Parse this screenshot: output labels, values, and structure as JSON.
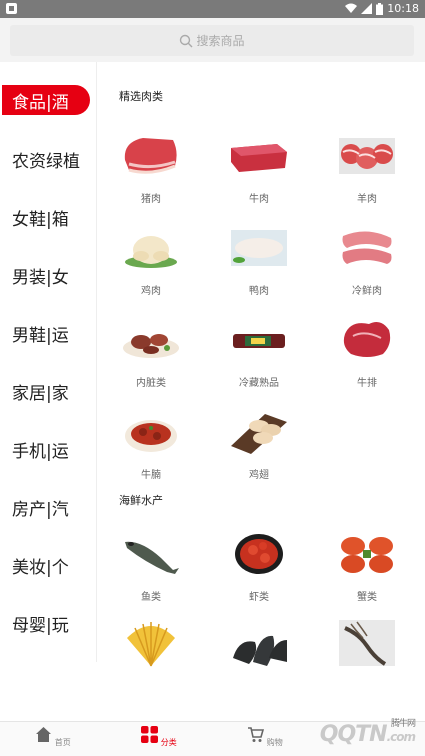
{
  "statusbar": {
    "time": "10:18"
  },
  "search": {
    "placeholder": "搜索商品"
  },
  "sidebar": {
    "items": [
      {
        "label": "食品|酒",
        "active": true
      },
      {
        "label": "农资绿植"
      },
      {
        "label": "女鞋|箱"
      },
      {
        "label": "男装|女"
      },
      {
        "label": "男鞋|运"
      },
      {
        "label": "家居|家"
      },
      {
        "label": "手机|运"
      },
      {
        "label": "房产|汽"
      },
      {
        "label": "美妆|个"
      },
      {
        "label": "母婴|玩"
      }
    ]
  },
  "sections": [
    {
      "title": "精选肉类",
      "items": [
        {
          "label": "猪肉",
          "icon": "pork-icon"
        },
        {
          "label": "牛肉",
          "icon": "beef-icon"
        },
        {
          "label": "羊肉",
          "icon": "lamb-icon"
        },
        {
          "label": "鸡肉",
          "icon": "chicken-icon"
        },
        {
          "label": "鸭肉",
          "icon": "duck-icon"
        },
        {
          "label": "冷鲜肉",
          "icon": "chilled-meat-icon"
        },
        {
          "label": "内脏类",
          "icon": "offal-icon"
        },
        {
          "label": "冷藏熟品",
          "icon": "sausage-icon"
        },
        {
          "label": "牛排",
          "icon": "steak-icon"
        },
        {
          "label": "牛腩",
          "icon": "brisket-icon"
        },
        {
          "label": "鸡翅",
          "icon": "chicken-wing-icon"
        }
      ]
    },
    {
      "title": "海鲜水产",
      "items": [
        {
          "label": "鱼类",
          "icon": "fish-icon"
        },
        {
          "label": "虾类",
          "icon": "shrimp-icon"
        },
        {
          "label": "蟹类",
          "icon": "crab-icon"
        },
        {
          "label": "",
          "icon": "scallop-icon"
        },
        {
          "label": "",
          "icon": "sea-cucumber-icon"
        },
        {
          "label": "",
          "icon": "squid-icon"
        }
      ]
    }
  ],
  "tabbar": {
    "tabs": [
      {
        "label": "首页",
        "icon": "home-icon"
      },
      {
        "label": "分类",
        "icon": "category-icon",
        "active": true
      },
      {
        "label": "购物",
        "icon": "cart-icon"
      }
    ]
  },
  "watermark": {
    "text": "QQTN",
    "suffix": ".com",
    "caption": "腾牛网"
  },
  "colors": {
    "accent": "#e60012",
    "statusbar": "#7a7a7a",
    "search_bg": "#ebebeb"
  }
}
